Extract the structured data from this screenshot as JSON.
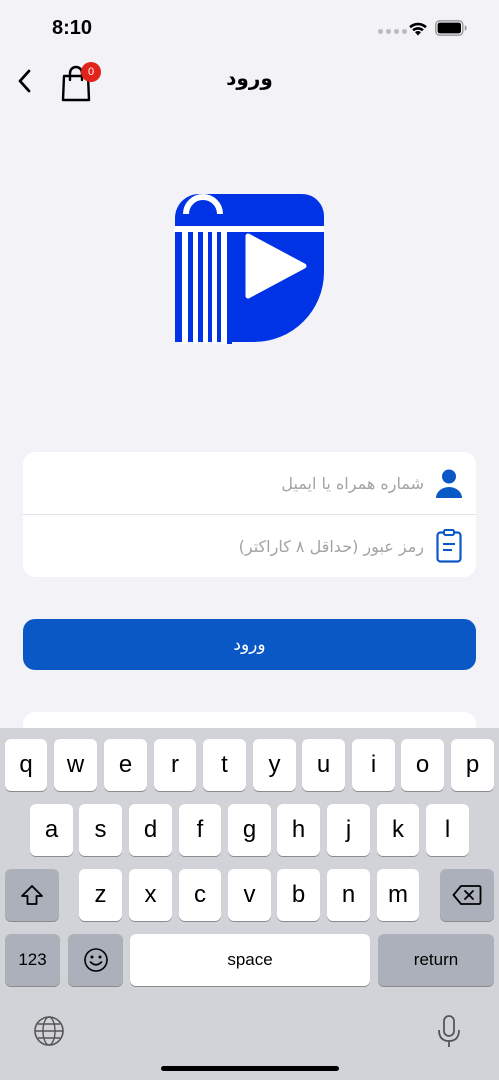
{
  "status_bar": {
    "time": "8:10"
  },
  "nav": {
    "title": "ورود",
    "cart_count": "0"
  },
  "form": {
    "username_placeholder": "شماره همراه یا ایمیل",
    "password_placeholder": "رمز عبور (حداقل ۸ کاراکتر)"
  },
  "login_button": "ورود",
  "colors": {
    "primary": "#0a58c5",
    "logo_blue": "#0033e6",
    "badge": "#e2231a"
  },
  "keyboard": {
    "row1": [
      "q",
      "w",
      "e",
      "r",
      "t",
      "y",
      "u",
      "i",
      "o",
      "p"
    ],
    "row2": [
      "a",
      "s",
      "d",
      "f",
      "g",
      "h",
      "j",
      "k",
      "l"
    ],
    "row3": [
      "z",
      "x",
      "c",
      "v",
      "b",
      "n",
      "m"
    ],
    "numbers_label": "123",
    "space_label": "space",
    "return_label": "return"
  }
}
